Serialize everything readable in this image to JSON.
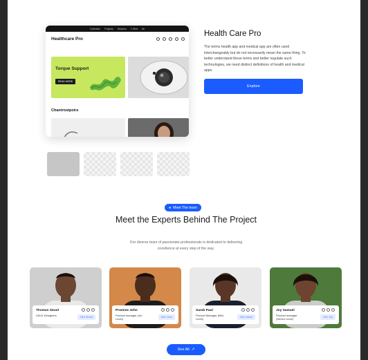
{
  "mockup": {
    "topbar_links": [
      "Collection",
      "Projects",
      "Relation",
      "T-Shirt",
      "Mr"
    ],
    "brand": "Healthcare Pro",
    "promo_title": "Torque Support",
    "promo_button": "READ MORE",
    "section_heading": "Chantrostpoirs"
  },
  "hero": {
    "title": "Health Care Pro",
    "description": "The terms health app and medical app are often used interchangeably but do not necessarily mean the same thing. To better understand these terms and better regulate such technologies, we need distinct definitions of health and medical apps.",
    "explore_label": "Explore"
  },
  "team": {
    "pill_label": "Meet The team",
    "title": "Meet the Experts Behind The Project",
    "subtitle": "Our diverse team of passionate professionals is dedicated to delivering excellence at every step of the way.",
    "members": [
      {
        "name": "Thomas Smart",
        "role": "UI/UX Designers",
        "hire": "Hire Smart",
        "bg": "#cfcfcf",
        "skin": "#6b4633"
      },
      {
        "name": "Promise John",
        "role": "Product manager (Jnr Level)",
        "hire": "Hire John",
        "bg": "#d4884a",
        "skin": "#4a2d1c"
      },
      {
        "name": "Sarah Paul",
        "role": "Product Manager (Mid-Level)",
        "hire": "Hire Sarah",
        "bg": "#e9e9e9",
        "skin": "#5a3626"
      },
      {
        "name": "Joy Samuel",
        "role": "Product manager (Senior Level)",
        "hire": "Hire Joy",
        "bg": "#4e7a3b",
        "skin": "#6e4430"
      }
    ],
    "see_all_label": "See All"
  },
  "colors": {
    "accent": "#1a5cff",
    "promo_green": "#c7e85e"
  }
}
